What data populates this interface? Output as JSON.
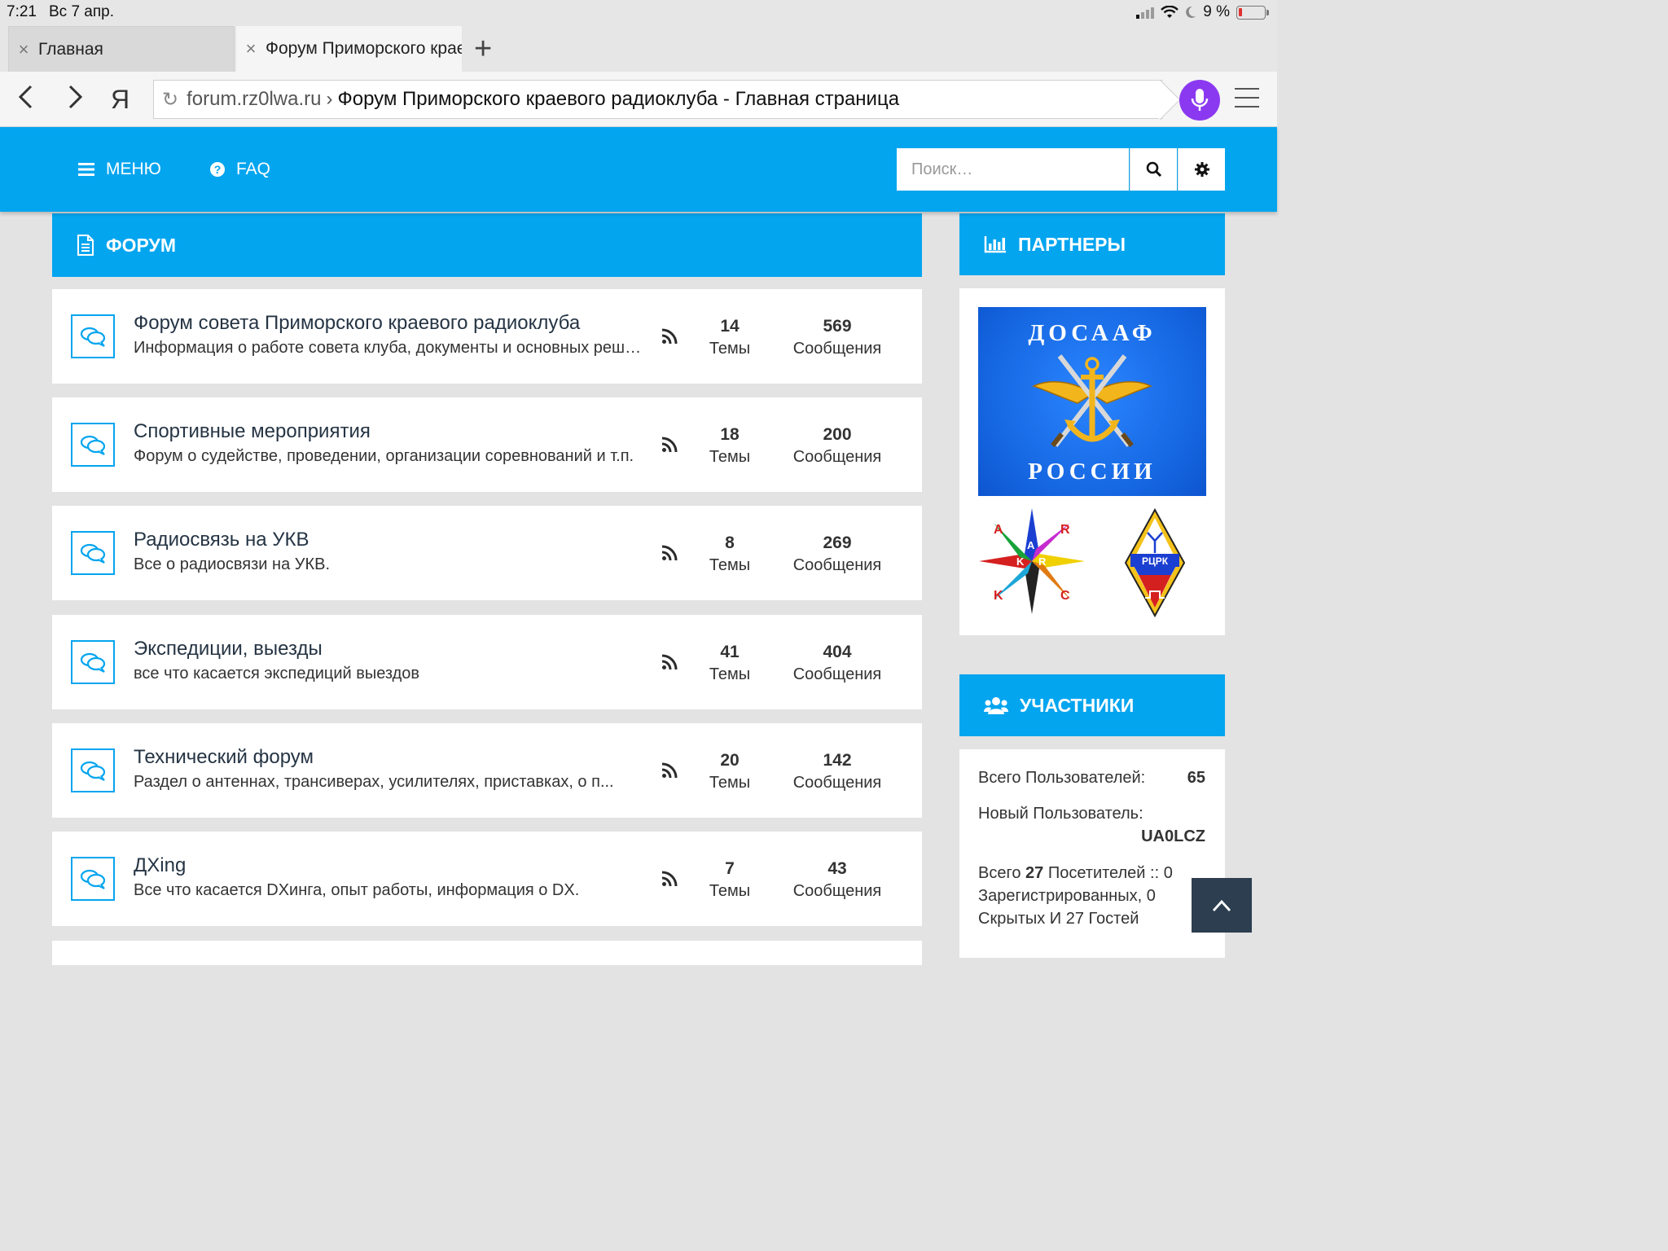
{
  "status": {
    "time": "7:21",
    "date": "Вс 7 апр.",
    "battery": "9 %"
  },
  "tabs": [
    {
      "label": "Главная"
    },
    {
      "label": "Форум Приморского краевого радиоклуба"
    }
  ],
  "address": {
    "domain": "forum.rz0lwa.ru",
    "separator": "›",
    "page_title": "Форум Приморского краевого радиоклуба - Главная страница",
    "browser_logo": "Я"
  },
  "header": {
    "menu_label": "МЕНЮ",
    "faq_label": "FAQ",
    "search_placeholder": "Поиск…"
  },
  "forum": {
    "heading": "ФОРУМ",
    "topics_label": "Темы",
    "posts_label": "Сообщения",
    "rows": [
      {
        "title": "Форум совета Приморского краевого радиоклуба",
        "desc": "Информация о работе совета клуба, документы и основных решениях",
        "topics": "14",
        "posts": "569"
      },
      {
        "title": "Спортивные мероприятия",
        "desc": "Форум о судействе, проведении, организации соревнований и т.п.",
        "topics": "18",
        "posts": "200"
      },
      {
        "title": "Радиосвязь на УКВ",
        "desc": "Все о радиосвязи на УКВ.",
        "topics": "8",
        "posts": "269"
      },
      {
        "title": "Экспедиции, выезды",
        "desc": "все что касается экспедиций выездов",
        "topics": "41",
        "posts": "404"
      },
      {
        "title": "Технический форум",
        "desc": "Раздел о антеннах, трансиверах, усилителях, приставках, о п...",
        "topics": "20",
        "posts": "142"
      },
      {
        "title": "ДXing",
        "desc": "Все что касается DXинга, опыт работы, информация о DX.",
        "topics": "7",
        "posts": "43"
      }
    ]
  },
  "sidebar": {
    "partners_heading": "ПАРТНЕРЫ",
    "dosaaf_top": "ДОСААФ",
    "dosaaf_bottom": "РОССИИ",
    "rcrk_label": "РЦРК",
    "members_heading": "УЧАСТНИКИ",
    "total_users_label": "Всего Пользователей:",
    "total_users": "65",
    "new_user_label": "Новый Пользователь:",
    "new_user": "UA0LCZ",
    "visitors_prefix": "Всего",
    "visitors_count": "27",
    "visitors_line1_rest": "Посетителей :: 0",
    "visitors_line2": "Зарегистрированных, 0",
    "visitors_line3": "Скрытых И 27 Гостей"
  },
  "colors": {
    "accent": "#04a5ef",
    "mic": "#8b39f0",
    "to_top": "#2c3e50"
  }
}
